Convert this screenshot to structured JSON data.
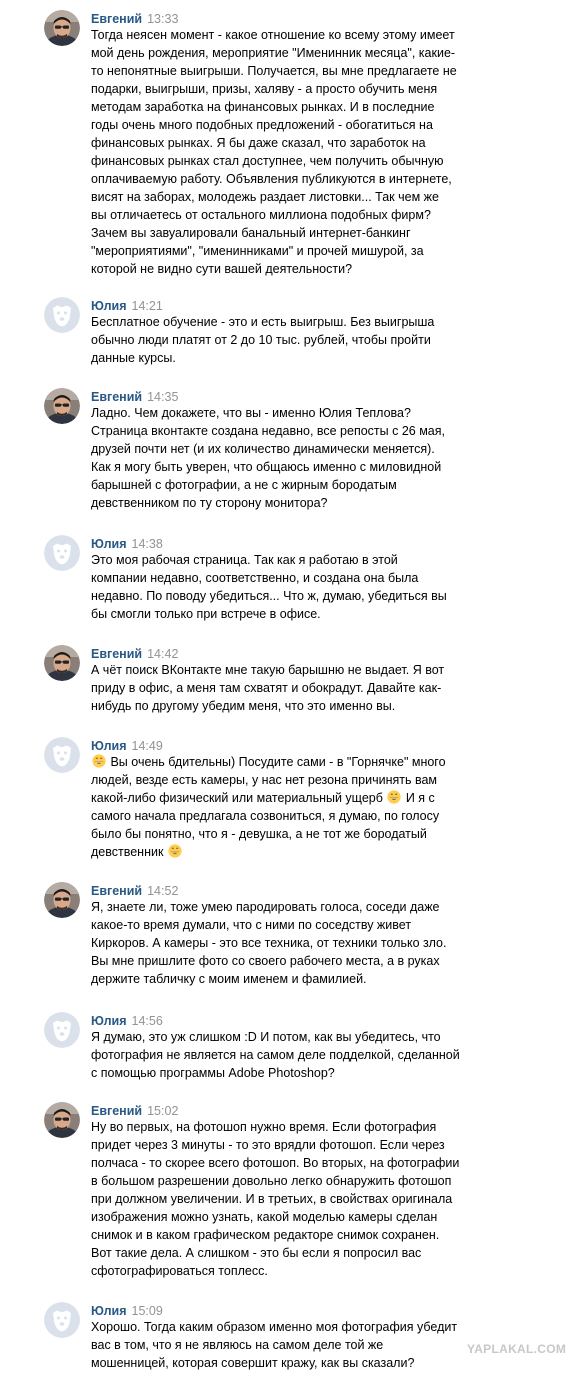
{
  "messages": [
    {
      "author": "Евгений",
      "time": "13:33",
      "avatar": "user-photo-avatar",
      "lines": [
        "Тогда неясен момент - какое отношение ко всему этому имеет",
        "мой день рождения, мероприятие \"Именинник месяца\", какие-",
        "то непонятные выигрыши. Получается, вы мне предлагаете не",
        "подарки, выигрыши, призы, халяву - а просто обучить меня",
        "методам заработка на финансовых рынках. И в последние",
        "годы очень много подобных предложений - обогатиться на",
        "финансовых рынках. Я бы даже сказал, что заработок на",
        "финансовых рынках стал доступнее, чем получить обычную",
        "оплачиваемую работу. Объявления публикуются в интернете,",
        "висят на заборах, молодежь раздает листовки... Так чем же",
        "вы отличаетесь от остального миллиона подобных фирм?",
        "Зачем вы завуалировали банальный интернет-банкинг",
        "\"мероприятиями\", \"именинниками\" и прочей мишурой, за",
        "которой не видно сути вашей деятельности?"
      ]
    },
    {
      "author": "Юлия",
      "time": "14:21",
      "avatar": "default-dog-avatar",
      "lines": [
        "Бесплатное обучение - это и есть выигрыш. Без выигрыша",
        "обычно люди платят от 2 до 10 тыс. рублей, чтобы пройти",
        "данные курсы."
      ]
    },
    {
      "author": "Евгений",
      "time": "14:35",
      "avatar": "user-photo-avatar",
      "lines": [
        "Ладно. Чем докажете, что вы - именно Юлия Теплова?",
        "Страница вконтакте создана недавно, все репосты с 26 мая,",
        "друзей почти нет (и их количество динамически меняется).",
        "Как я могу быть уверен, что общаюсь именно с миловидной",
        "барышней с фотографии, а не с жирным бородатым",
        "девственником по ту сторону монитора?"
      ]
    },
    {
      "author": "Юлия",
      "time": "14:38",
      "avatar": "default-dog-avatar",
      "lines": [
        "Это моя рабочая страница. Так как я работаю в этой",
        "компании недавно, соответственно, и создана она была",
        "недавно. По поводу убедиться... Что ж, думаю, убедиться вы",
        "бы смогли только при встрече в офисе."
      ]
    },
    {
      "author": "Евгений",
      "time": "14:42",
      "avatar": "user-photo-avatar",
      "lines": [
        "А чёт поиск ВКонтакте мне такую барышню не выдает. Я вот",
        "приду в офис, а меня там схватят и обокрадут. Давайте как-",
        "нибудь по другому убедим меня, что это именно вы."
      ]
    },
    {
      "author": "Юлия",
      "time": "14:49",
      "avatar": "default-dog-avatar",
      "lines": [
        "{grin} Вы очень бдительны) Посудите сами - в \"Горнячке\" много",
        "людей, везде есть камеры, у нас нет резона причинять вам",
        "какой-либо физический или материальный ущерб {grin} И я с",
        "самого начала предлагала созвониться, я думаю, по голосу",
        "было бы понятно, что я - девушка, а не тот же бородатый",
        "девственник {grin}"
      ]
    },
    {
      "author": "Евгений",
      "time": "14:52",
      "avatar": "user-photo-avatar",
      "lines": [
        "Я, знаете ли, тоже умею пародировать голоса, соседи даже",
        "какое-то время думали, что с ними по соседству живет",
        "Киркоров. А камеры - это все техника, от техники только зло.",
        "Вы мне пришлите фото со своего рабочего места, а в руках",
        "держите табличку с моим именем и фамилией."
      ]
    },
    {
      "author": "Юлия",
      "time": "14:56",
      "avatar": "default-dog-avatar",
      "lines": [
        "Я думаю, это уж слишком :D И потом, как вы убедитесь, что",
        "фотография не является на самом деле подделкой, сделанной",
        "с помощью программы Adobe Photoshop?"
      ]
    },
    {
      "author": "Евгений",
      "time": "15:02",
      "avatar": "user-photo-avatar",
      "lines": [
        "Ну во первых, на фотошоп нужно время. Если фотография",
        "придет через 3 минуты - то это врядли фотошоп. Если через",
        "полчаса - то скорее всего фотошоп. Во вторых, на фотографии",
        "в большом разрешении довольно легко обнаружить фотошоп",
        "при должном увеличении. И в третьих, в свойствах оригинала",
        "изображения можно узнать, какой моделью камеры сделан",
        "снимок и в каком графическом редакторе снимок сохранен.",
        "Вот такие дела. А слишком - это бы если я попросил вас",
        "сфотографироваться топлесс."
      ]
    },
    {
      "author": "Юлия",
      "time": "15:09",
      "avatar": "default-dog-avatar",
      "lines": [
        "Хорошо. Тогда каким образом именно моя фотография убедит",
        "вас в том, что я не являюсь на самом деле той же",
        "мошенницей, которая совершит кражу, как вы сказали?"
      ]
    }
  ],
  "emoji_icon": "grinning-face-icon",
  "watermark": "YAPLAKAL.COM",
  "colors": {
    "author": "#2a5885",
    "time": "#939393",
    "text": "#000000",
    "avatar_default_bg": "#dae1ea",
    "avatar_default_fg": "#ffffff",
    "watermark": "#c8c8c8"
  }
}
